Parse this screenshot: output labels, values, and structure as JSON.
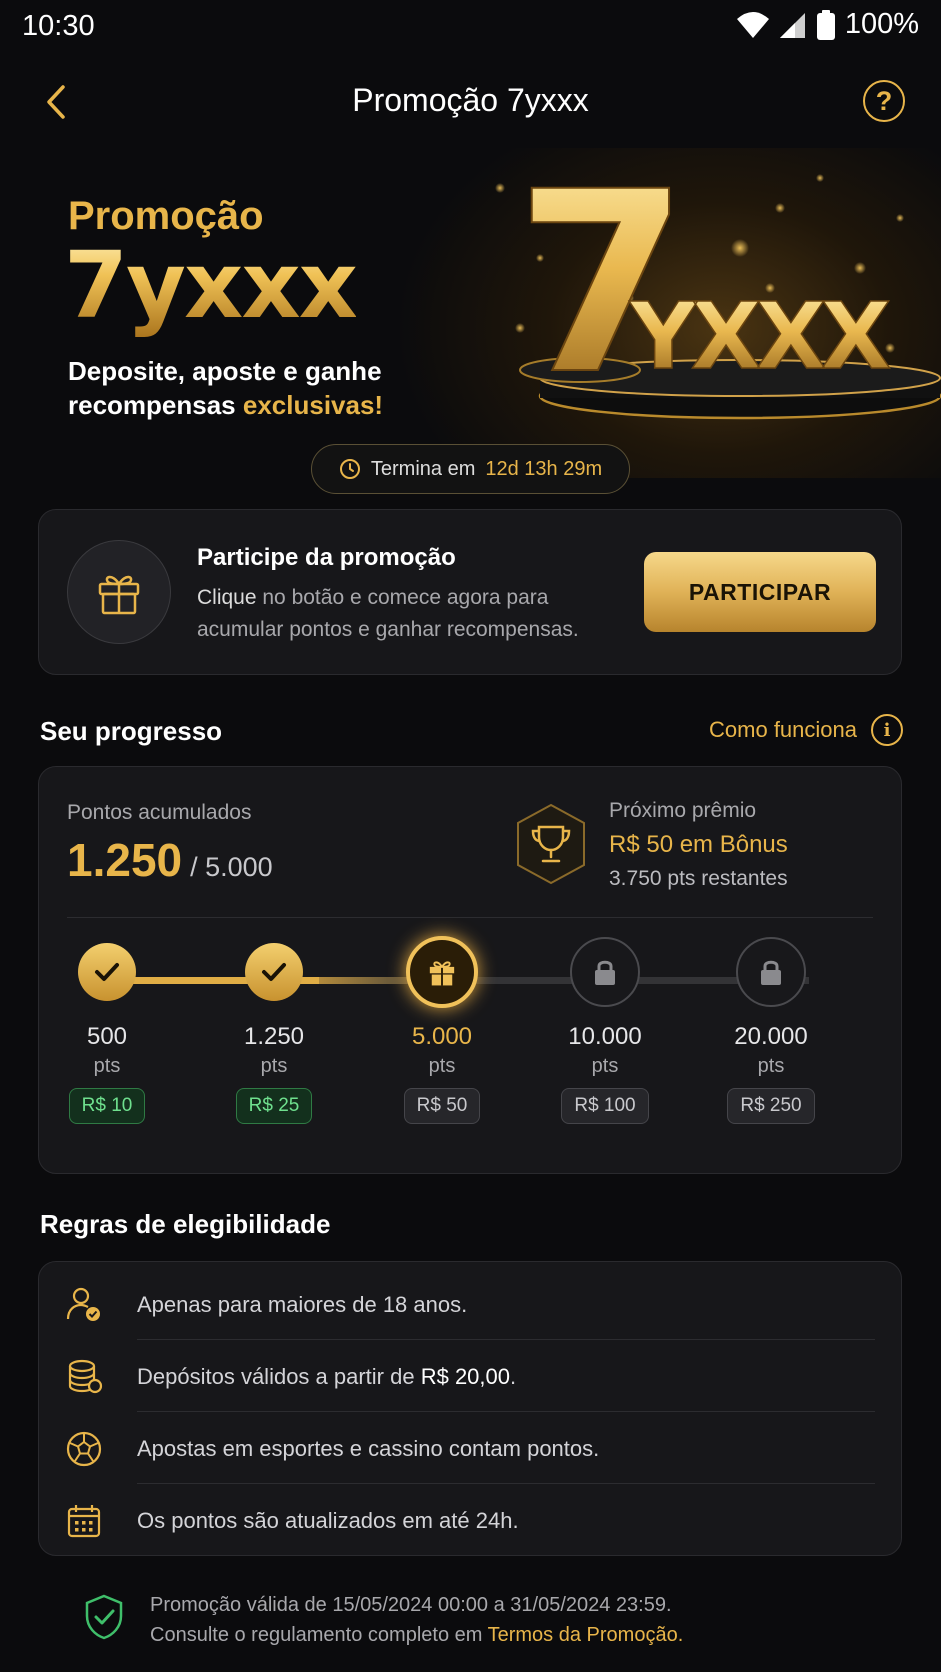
{
  "status_bar": {
    "time": "10:30",
    "battery": "100%"
  },
  "header": {
    "title": "Promoção 7yxxx"
  },
  "hero": {
    "subtitle": "Promoção",
    "brand": "7yxxx",
    "desc_line1": "Deposite, aposte e ganhe",
    "desc_line2_start": "recompensas ",
    "desc_line2_highlight": "exclusivas!",
    "art_number": "7",
    "art_text": "YXXX"
  },
  "timer": {
    "label": "Termina em",
    "value": "12d 13h 29m"
  },
  "participate": {
    "title": "Participe da promoção",
    "text_strong": "Clique",
    "text_rest": " no botão e comece agora para acumular pontos e ganhar recompensas.",
    "button_label": "PARTICIPAR"
  },
  "progress": {
    "section_title": "Seu progresso",
    "how_link": "Como funciona",
    "points_label": "Pontos acumulados",
    "points_current": "1.250",
    "points_total": "/ 5.000",
    "next_label": "Próximo prêmio",
    "next_prize": "R$ 50 em Bônus",
    "next_remaining": "3.750 pts restantes",
    "unit": "pts",
    "milestones": [
      {
        "pts": "500",
        "reward": "R$ 10",
        "state": "done"
      },
      {
        "pts": "1.250",
        "reward": "R$ 25",
        "state": "done"
      },
      {
        "pts": "5.000",
        "reward": "R$ 50",
        "state": "current"
      },
      {
        "pts": "10.000",
        "reward": "R$ 100",
        "state": "locked"
      },
      {
        "pts": "20.000",
        "reward": "R$ 250",
        "state": "locked"
      }
    ]
  },
  "rules": {
    "section_title": "Regras de elegibilidade",
    "items": [
      {
        "text": "Apenas para maiores de 18 anos.",
        "icon": "user-check-icon"
      },
      {
        "text_start": "Depósitos válidos a partir de ",
        "text_strong": "R$ 20,00",
        "text_end": ".",
        "icon": "coins-icon"
      },
      {
        "text": "Apostas em esportes e cassino contam pontos.",
        "icon": "soccer-ball-icon"
      },
      {
        "text": "Os pontos são atualizados em até 24h.",
        "icon": "calendar-icon"
      }
    ]
  },
  "footer": {
    "line1": "Promoção válida de 15/05/2024 00:00 a 31/05/2024 23:59.",
    "line2_start": "Consulte o regulamento completo em ",
    "terms_link": "Termos da Promoção."
  },
  "colors": {
    "accent": "#e8b54a",
    "success": "#6fe08e",
    "background": "#0b0b0d",
    "card": "#17171a"
  }
}
